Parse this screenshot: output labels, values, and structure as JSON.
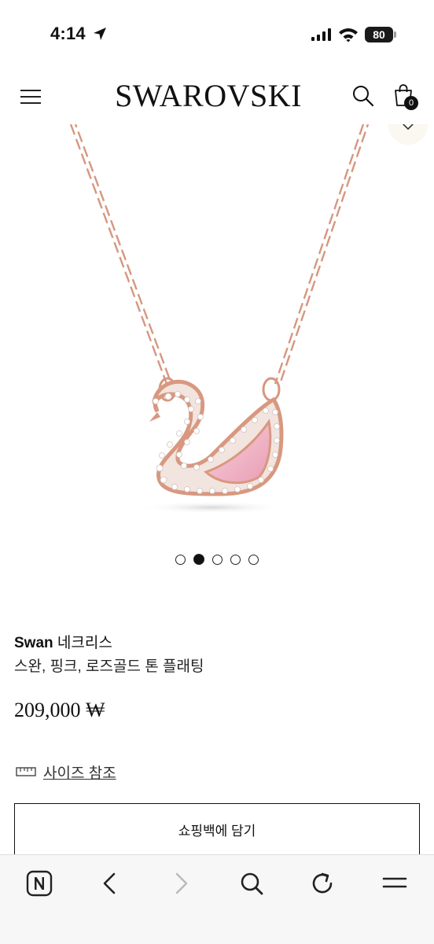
{
  "status_bar": {
    "time": "4:14",
    "battery": "80"
  },
  "header": {
    "brand": "SWAROVSKI",
    "bag_count": "0"
  },
  "carousel": {
    "total": 5,
    "active_index": 1
  },
  "product": {
    "name_bold": "Swan",
    "name_rest": " 네크리스",
    "description": "스완, 핑크, 로즈골드 톤 플래팅",
    "price": "209,000 ₩",
    "size_guide": "사이즈 참조",
    "add_to_bag": "쇼핑백에 담기"
  },
  "colors": {
    "chain": "#d9a08a",
    "pink_stone": "#f1b9c9"
  },
  "icons": {
    "status": [
      "location-arrow-icon",
      "signal-icon",
      "wifi-icon",
      "battery-icon"
    ],
    "header": [
      "menu-icon",
      "search-icon",
      "shopping-bag-icon",
      "chevron-down-icon"
    ],
    "browser": [
      "n-logo-icon",
      "back-icon",
      "forward-icon",
      "search-icon",
      "refresh-icon",
      "menu-icon"
    ]
  }
}
